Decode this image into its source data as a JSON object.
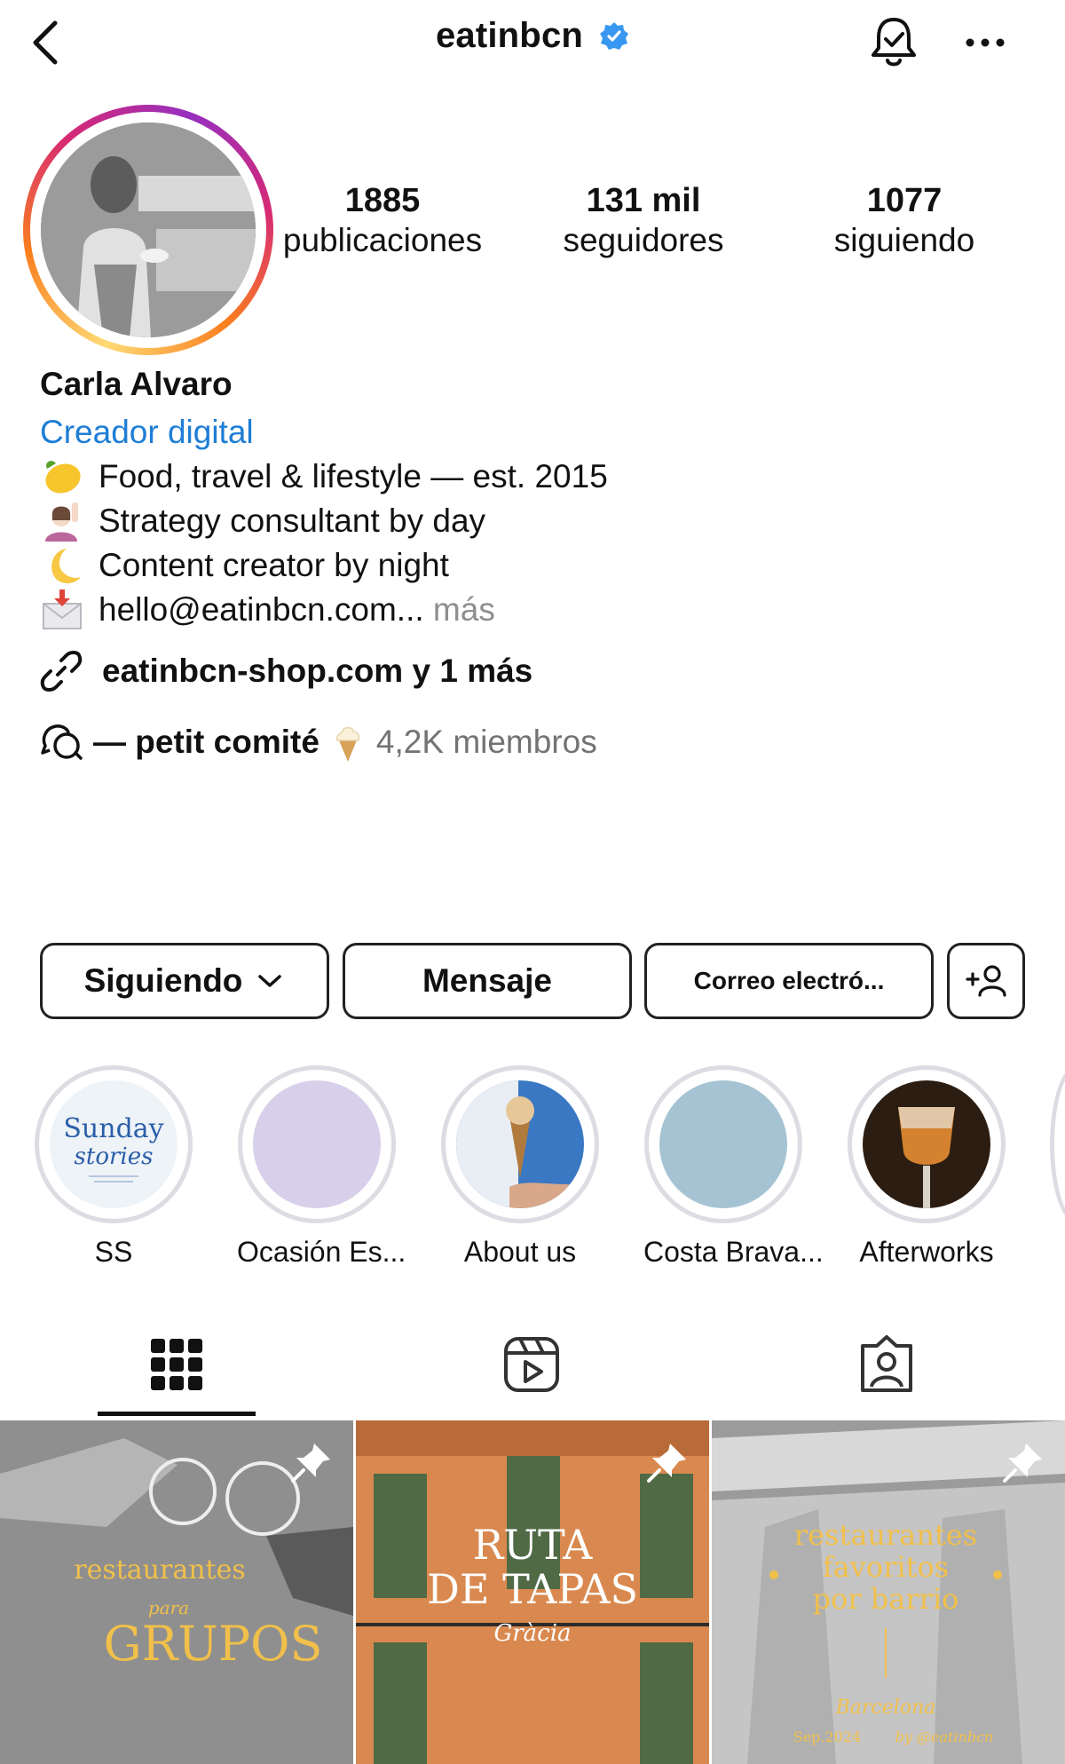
{
  "header": {
    "username": "eatinbcn",
    "icons": [
      "back-arrow-icon",
      "verified-badge-icon",
      "notification-bell-icon",
      "more-options-icon"
    ]
  },
  "stats": [
    {
      "value": "1885",
      "label": "publicaciones"
    },
    {
      "value": "131 mil",
      "label": "seguidores"
    },
    {
      "value": "1077",
      "label": "siguiendo"
    }
  ],
  "bio": {
    "name": "Carla Alvaro",
    "category": "Creador digital",
    "lines": [
      {
        "emoji": "lemon",
        "text": "Food, travel & lifestyle — est. 2015"
      },
      {
        "emoji": "person-raising-hand",
        "text": "Strategy consultant by day"
      },
      {
        "emoji": "crescent-moon",
        "text": "Content creator by night"
      },
      {
        "emoji": "envelope-with-arrow",
        "text": "hello@eatinbcn.com...",
        "more": "más"
      }
    ],
    "link": "eatinbcn-shop.com y 1 más",
    "community": {
      "name": "— petit comité",
      "emoji": "soft-ice-cream",
      "members": "4,2K miembros"
    }
  },
  "buttons": {
    "following": "Siguiendo",
    "message": "Mensaje",
    "email": "Correo electró...",
    "add_person_icon": "add-person-icon"
  },
  "highlights": [
    {
      "label": "SS",
      "cover_text": "Sunday stories",
      "color": "#eef3f8"
    },
    {
      "label": "Ocasión Es...",
      "color": "#d8cfea"
    },
    {
      "label": "About us",
      "color": "#3a78c4"
    },
    {
      "label": "Costa Brava...",
      "color": "#a5c3d3"
    },
    {
      "label": "Afterworks",
      "color": "#2b1d12"
    }
  ],
  "tabs": [
    {
      "name": "grid",
      "icon": "grid-icon",
      "active": true
    },
    {
      "name": "reels",
      "icon": "reels-icon",
      "active": false
    },
    {
      "name": "tagged",
      "icon": "tagged-person-icon",
      "active": false
    }
  ],
  "posts": [
    {
      "lines": [
        "restaurantes",
        "para",
        "GRUPOS"
      ],
      "pinned": true
    },
    {
      "lines": [
        "RUTA",
        "DE TAPAS",
        "Gràcia"
      ],
      "pinned": true
    },
    {
      "lines": [
        "restaurantes",
        "favoritos",
        "por barrio",
        "Barcelona",
        "Sep.2024",
        "by @eatinbcn"
      ],
      "pinned": true
    }
  ],
  "colors": {
    "accent_link": "#1e7ed6",
    "muted": "#8e8e8e",
    "post_text_gold": "#f1c04a"
  }
}
